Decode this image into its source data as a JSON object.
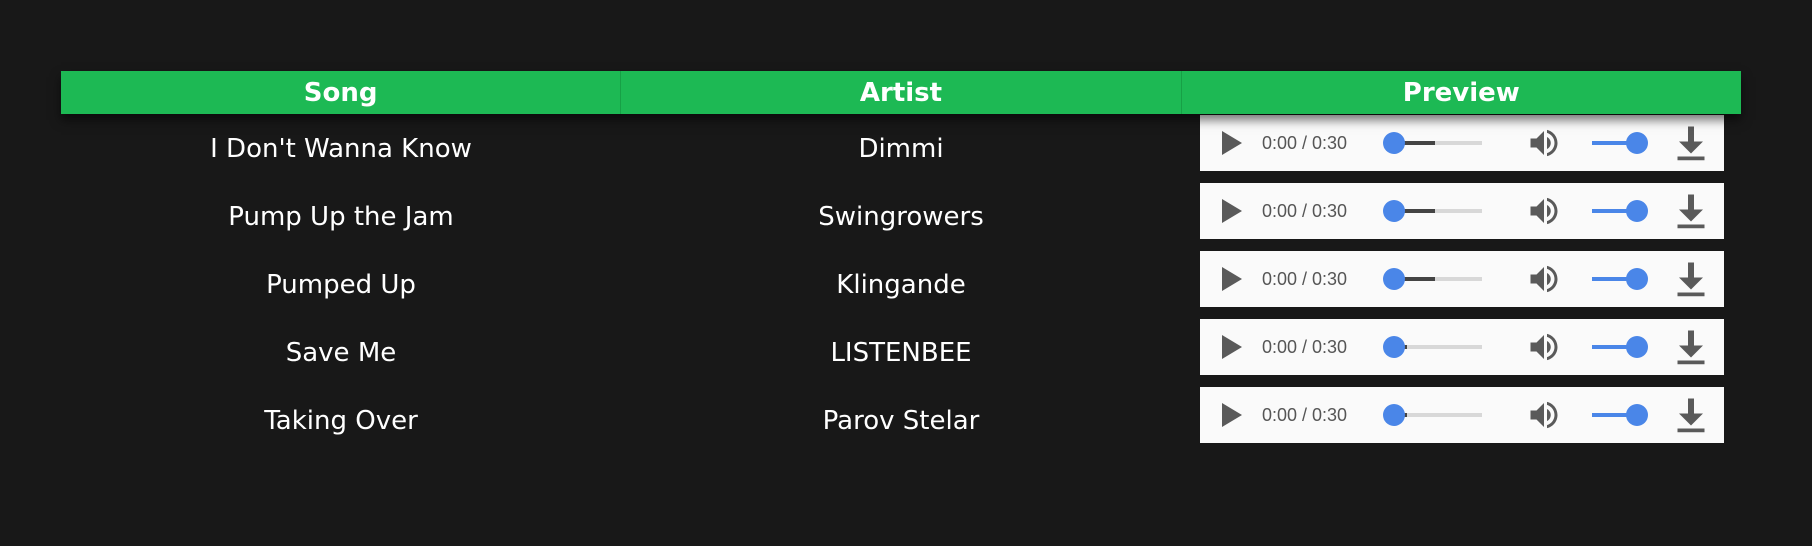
{
  "table": {
    "headers": {
      "song": "Song",
      "artist": "Artist",
      "preview": "Preview"
    },
    "rows": [
      {
        "song": "I Don't Wanna Know",
        "artist": "Dimmi",
        "time": "0:00 / 0:30",
        "buffered": 0.5
      },
      {
        "song": "Pump Up the Jam",
        "artist": "Swingrowers",
        "time": "0:00 / 0:30",
        "buffered": 0.5
      },
      {
        "song": "Pumped Up",
        "artist": "Klingande",
        "time": "0:00 / 0:30",
        "buffered": 0.5
      },
      {
        "song": "Save Me",
        "artist": "LISTENBEE",
        "time": "0:00 / 0:30",
        "buffered": 0.2
      },
      {
        "song": "Taking Over",
        "artist": "Parov Stelar",
        "time": "0:00 / 0:30",
        "buffered": 0.2
      }
    ]
  },
  "player": {
    "volume": 1.0,
    "icons": {
      "play": "play-icon",
      "volume": "volume-icon",
      "download": "download-icon"
    }
  },
  "colors": {
    "background": "#181818",
    "header": "#1db954",
    "accent": "#4a86e8"
  }
}
